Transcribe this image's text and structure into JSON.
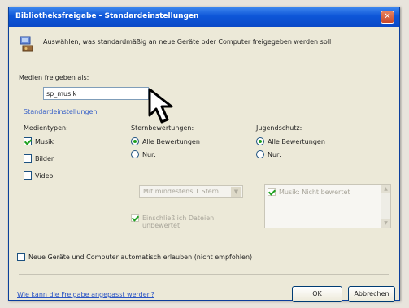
{
  "window": {
    "title": "Bibliotheksfreigabe - Standardeinstellungen",
    "close_glyph": "✕"
  },
  "intro_text": "Auswählen, was standardmäßig an neue Geräte oder Computer freigegeben werden soll",
  "share_as": {
    "label": "Medien freigeben als:",
    "value": "sp_musik"
  },
  "defaults_link": "Standardeinstellungen",
  "media_types": {
    "title": "Medientypen:",
    "items": [
      {
        "label": "Musik",
        "checked": true
      },
      {
        "label": "Bilder",
        "checked": false
      },
      {
        "label": "Video",
        "checked": false
      }
    ]
  },
  "star_ratings": {
    "title": "Sternbewertungen:",
    "options": [
      {
        "label": "Alle Bewertungen",
        "selected": true
      },
      {
        "label": "Nur:",
        "selected": false
      }
    ],
    "combo_value": "Mit mindestens 1 Stern",
    "include_unrated": {
      "label_line1": "Einschließlich Dateien",
      "label_line2": "unbewertet",
      "checked": true
    }
  },
  "parental": {
    "title": "Jugendschutz:",
    "options": [
      {
        "label": "Alle Bewertungen",
        "selected": true
      },
      {
        "label": "Nur:",
        "selected": false
      }
    ],
    "list_items": [
      {
        "label": "Musik: Nicht bewertet",
        "checked": true
      }
    ]
  },
  "auto_allow": {
    "label": "Neue Geräte und Computer automatisch erlauben (nicht empfohlen)",
    "checked": false
  },
  "help_link": "Wie kann die Freigabe angepasst werden?",
  "buttons": {
    "ok": "OK",
    "cancel": "Abbrechen"
  },
  "icons": {
    "share": "media-share-icon",
    "cursor": "mouse-cursor-arrow"
  }
}
